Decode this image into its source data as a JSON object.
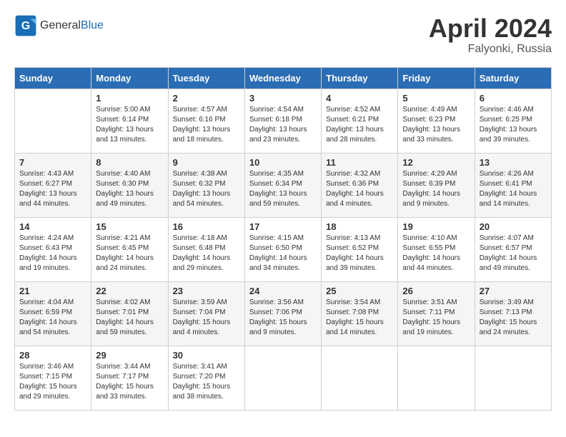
{
  "header": {
    "logo_general": "General",
    "logo_blue": "Blue",
    "month": "April 2024",
    "location": "Falyonki, Russia"
  },
  "days_of_week": [
    "Sunday",
    "Monday",
    "Tuesday",
    "Wednesday",
    "Thursday",
    "Friday",
    "Saturday"
  ],
  "weeks": [
    [
      {
        "day": "",
        "info": ""
      },
      {
        "day": "1",
        "info": "Sunrise: 5:00 AM\nSunset: 6:14 PM\nDaylight: 13 hours\nand 13 minutes."
      },
      {
        "day": "2",
        "info": "Sunrise: 4:57 AM\nSunset: 6:16 PM\nDaylight: 13 hours\nand 18 minutes."
      },
      {
        "day": "3",
        "info": "Sunrise: 4:54 AM\nSunset: 6:18 PM\nDaylight: 13 hours\nand 23 minutes."
      },
      {
        "day": "4",
        "info": "Sunrise: 4:52 AM\nSunset: 6:21 PM\nDaylight: 13 hours\nand 28 minutes."
      },
      {
        "day": "5",
        "info": "Sunrise: 4:49 AM\nSunset: 6:23 PM\nDaylight: 13 hours\nand 33 minutes."
      },
      {
        "day": "6",
        "info": "Sunrise: 4:46 AM\nSunset: 6:25 PM\nDaylight: 13 hours\nand 39 minutes."
      }
    ],
    [
      {
        "day": "7",
        "info": "Sunrise: 4:43 AM\nSunset: 6:27 PM\nDaylight: 13 hours\nand 44 minutes."
      },
      {
        "day": "8",
        "info": "Sunrise: 4:40 AM\nSunset: 6:30 PM\nDaylight: 13 hours\nand 49 minutes."
      },
      {
        "day": "9",
        "info": "Sunrise: 4:38 AM\nSunset: 6:32 PM\nDaylight: 13 hours\nand 54 minutes."
      },
      {
        "day": "10",
        "info": "Sunrise: 4:35 AM\nSunset: 6:34 PM\nDaylight: 13 hours\nand 59 minutes."
      },
      {
        "day": "11",
        "info": "Sunrise: 4:32 AM\nSunset: 6:36 PM\nDaylight: 14 hours\nand 4 minutes."
      },
      {
        "day": "12",
        "info": "Sunrise: 4:29 AM\nSunset: 6:39 PM\nDaylight: 14 hours\nand 9 minutes."
      },
      {
        "day": "13",
        "info": "Sunrise: 4:26 AM\nSunset: 6:41 PM\nDaylight: 14 hours\nand 14 minutes."
      }
    ],
    [
      {
        "day": "14",
        "info": "Sunrise: 4:24 AM\nSunset: 6:43 PM\nDaylight: 14 hours\nand 19 minutes."
      },
      {
        "day": "15",
        "info": "Sunrise: 4:21 AM\nSunset: 6:45 PM\nDaylight: 14 hours\nand 24 minutes."
      },
      {
        "day": "16",
        "info": "Sunrise: 4:18 AM\nSunset: 6:48 PM\nDaylight: 14 hours\nand 29 minutes."
      },
      {
        "day": "17",
        "info": "Sunrise: 4:15 AM\nSunset: 6:50 PM\nDaylight: 14 hours\nand 34 minutes."
      },
      {
        "day": "18",
        "info": "Sunrise: 4:13 AM\nSunset: 6:52 PM\nDaylight: 14 hours\nand 39 minutes."
      },
      {
        "day": "19",
        "info": "Sunrise: 4:10 AM\nSunset: 6:55 PM\nDaylight: 14 hours\nand 44 minutes."
      },
      {
        "day": "20",
        "info": "Sunrise: 4:07 AM\nSunset: 6:57 PM\nDaylight: 14 hours\nand 49 minutes."
      }
    ],
    [
      {
        "day": "21",
        "info": "Sunrise: 4:04 AM\nSunset: 6:59 PM\nDaylight: 14 hours\nand 54 minutes."
      },
      {
        "day": "22",
        "info": "Sunrise: 4:02 AM\nSunset: 7:01 PM\nDaylight: 14 hours\nand 59 minutes."
      },
      {
        "day": "23",
        "info": "Sunrise: 3:59 AM\nSunset: 7:04 PM\nDaylight: 15 hours\nand 4 minutes."
      },
      {
        "day": "24",
        "info": "Sunrise: 3:56 AM\nSunset: 7:06 PM\nDaylight: 15 hours\nand 9 minutes."
      },
      {
        "day": "25",
        "info": "Sunrise: 3:54 AM\nSunset: 7:08 PM\nDaylight: 15 hours\nand 14 minutes."
      },
      {
        "day": "26",
        "info": "Sunrise: 3:51 AM\nSunset: 7:11 PM\nDaylight: 15 hours\nand 19 minutes."
      },
      {
        "day": "27",
        "info": "Sunrise: 3:49 AM\nSunset: 7:13 PM\nDaylight: 15 hours\nand 24 minutes."
      }
    ],
    [
      {
        "day": "28",
        "info": "Sunrise: 3:46 AM\nSunset: 7:15 PM\nDaylight: 15 hours\nand 29 minutes."
      },
      {
        "day": "29",
        "info": "Sunrise: 3:44 AM\nSunset: 7:17 PM\nDaylight: 15 hours\nand 33 minutes."
      },
      {
        "day": "30",
        "info": "Sunrise: 3:41 AM\nSunset: 7:20 PM\nDaylight: 15 hours\nand 38 minutes."
      },
      {
        "day": "",
        "info": ""
      },
      {
        "day": "",
        "info": ""
      },
      {
        "day": "",
        "info": ""
      },
      {
        "day": "",
        "info": ""
      }
    ]
  ]
}
